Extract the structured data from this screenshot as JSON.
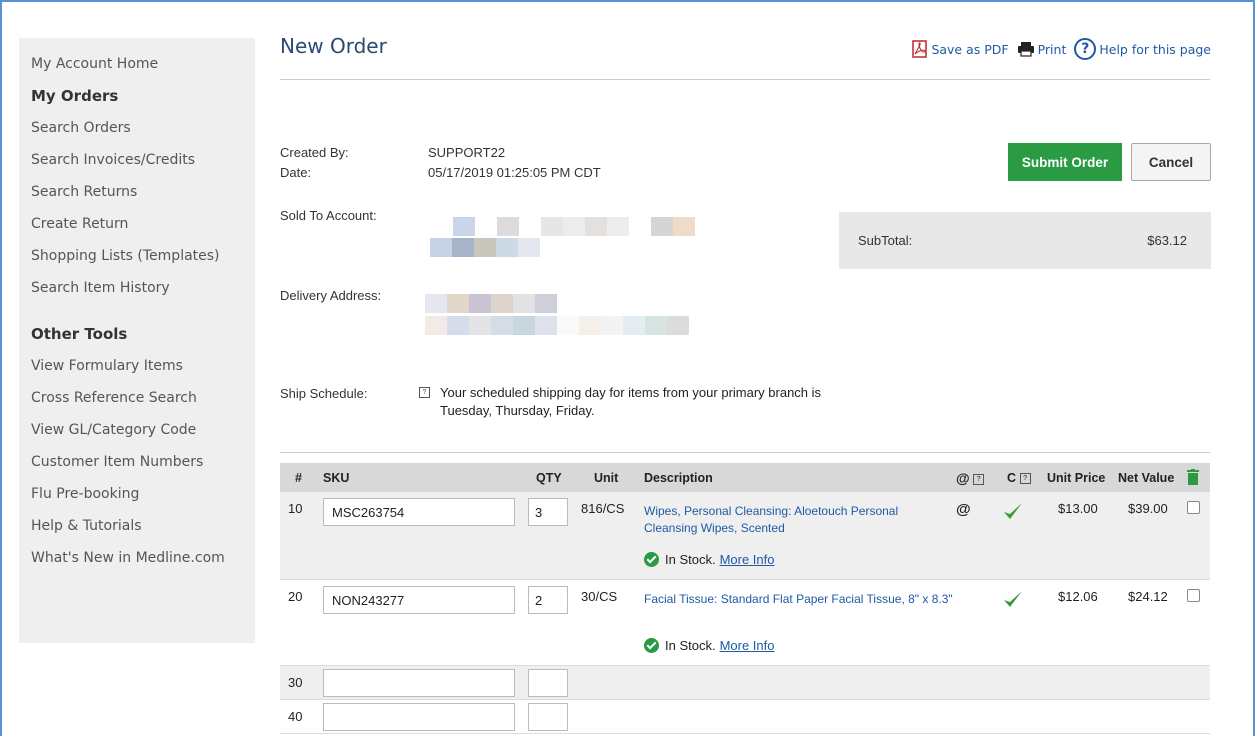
{
  "sidebar": {
    "links_top": [
      "My Account Home"
    ],
    "my_orders_heading": "My Orders",
    "my_orders": [
      "Search Orders",
      "Search Invoices/Credits",
      "Search Returns",
      "Create Return",
      "Shopping Lists (Templates)",
      "Search Item History"
    ],
    "other_tools_heading": "Other Tools",
    "other_tools": [
      "View Formulary Items",
      "Cross Reference Search",
      "View GL/Category Code",
      "Customer Item Numbers",
      "Flu Pre-booking",
      "Help & Tutorials",
      "What's New in Medline.com"
    ]
  },
  "header": {
    "title": "New Order",
    "save_pdf": "Save as PDF",
    "print": "Print",
    "help": "Help for this page"
  },
  "info": {
    "created_by_label": "Created By:",
    "created_by": "SUPPORT22",
    "date_label": "Date:",
    "date": "05/17/2019 01:25:05 PM CDT",
    "sold_to_label": "Sold To Account:",
    "delivery_label": "Delivery Address:",
    "ship_label": "Ship Schedule:",
    "ship_text": "Your scheduled shipping day for items from your primary branch is Tuesday, Thursday, Friday."
  },
  "actions": {
    "submit": "Submit Order",
    "cancel": "Cancel"
  },
  "subtotal": {
    "label": "SubTotal:",
    "value": "$63.12"
  },
  "table": {
    "headers": {
      "num": "#",
      "sku": "SKU",
      "qty": "QTY",
      "unit": "Unit",
      "desc": "Description",
      "c": "C",
      "unit_price": "Unit Price",
      "net_value": "Net Value"
    },
    "rows": [
      {
        "num": "10",
        "sku": "MSC263754",
        "qty": "3",
        "unit": "816/CS",
        "desc": "Wipes, Personal Cleansing: Aloetouch Personal Cleansing Wipes, Scented",
        "stock": "In Stock.",
        "more": "More Info",
        "unit_price": "$13.00",
        "net_value": "$39.00"
      },
      {
        "num": "20",
        "sku": "NON243277",
        "qty": "2",
        "unit": "30/CS",
        "desc": "Facial Tissue: Standard Flat Paper Facial Tissue, 8\" x 8.3\"",
        "stock": "In Stock.",
        "more": "More Info",
        "unit_price": "$12.06",
        "net_value": "$24.12"
      },
      {
        "num": "30"
      },
      {
        "num": "40"
      }
    ]
  },
  "colors": {
    "accent_green": "#2a9a43",
    "link_blue": "#1f5aa5",
    "title_blue": "#2a4a73"
  }
}
